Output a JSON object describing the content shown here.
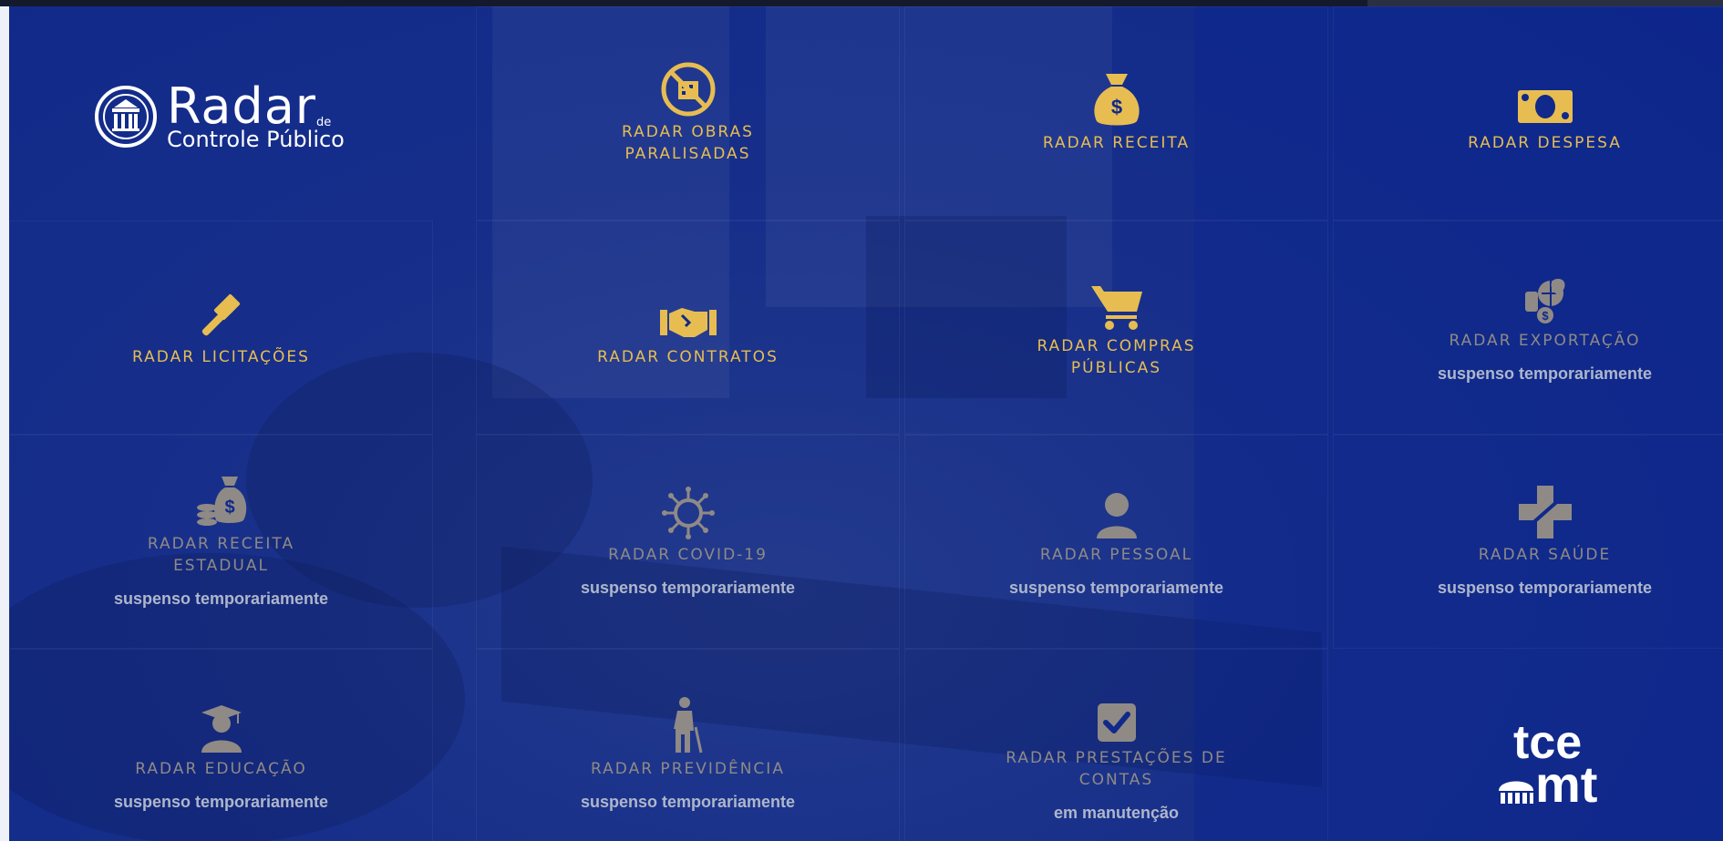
{
  "brand": {
    "main": "Radar",
    "de": "de",
    "sub": "Controle Público",
    "footer_logo_top": "tce",
    "footer_logo_bottom": "mt"
  },
  "colors": {
    "active": "#e7bd52",
    "inactive": "#8f8a86",
    "background": "#10298a",
    "status": "#aeb6cb"
  },
  "tiles": [
    {
      "label": "RADAR OBRAS PARALISADAS",
      "icon": "no-building-icon",
      "status": ""
    },
    {
      "label": "RADAR RECEITA",
      "icon": "money-bag-icon",
      "status": ""
    },
    {
      "label": "RADAR DESPESA",
      "icon": "banknote-icon",
      "status": ""
    },
    {
      "label": "RADAR LICITAÇÕES",
      "icon": "gavel-icon",
      "status": ""
    },
    {
      "label": "RADAR CONTRATOS",
      "icon": "handshake-icon",
      "status": ""
    },
    {
      "label": "RADAR COMPRAS PÚBLICAS",
      "icon": "shopping-cart-icon",
      "status": ""
    },
    {
      "label": "RADAR EXPORTAÇÃO",
      "icon": "export-globe-icon",
      "status": "suspenso temporariamente"
    },
    {
      "label": "RADAR RECEITA ESTADUAL",
      "icon": "coins-bag-icon",
      "status": "suspenso temporariamente"
    },
    {
      "label": "RADAR COVID-19",
      "icon": "virus-icon",
      "status": "suspenso temporariamente"
    },
    {
      "label": "RADAR PESSOAL",
      "icon": "person-icon",
      "status": "suspenso temporariamente"
    },
    {
      "label": "RADAR SAÚDE",
      "icon": "medical-cross-icon",
      "status": "suspenso temporariamente"
    },
    {
      "label": "RADAR EDUCAÇÃO",
      "icon": "graduate-icon",
      "status": "suspenso temporariamente"
    },
    {
      "label": "RADAR PREVIDÊNCIA",
      "icon": "elder-icon",
      "status": "suspenso temporariamente"
    },
    {
      "label": "RADAR PRESTAÇÕES DE CONTAS",
      "icon": "checkbox-icon",
      "status": "em manutenção"
    }
  ]
}
